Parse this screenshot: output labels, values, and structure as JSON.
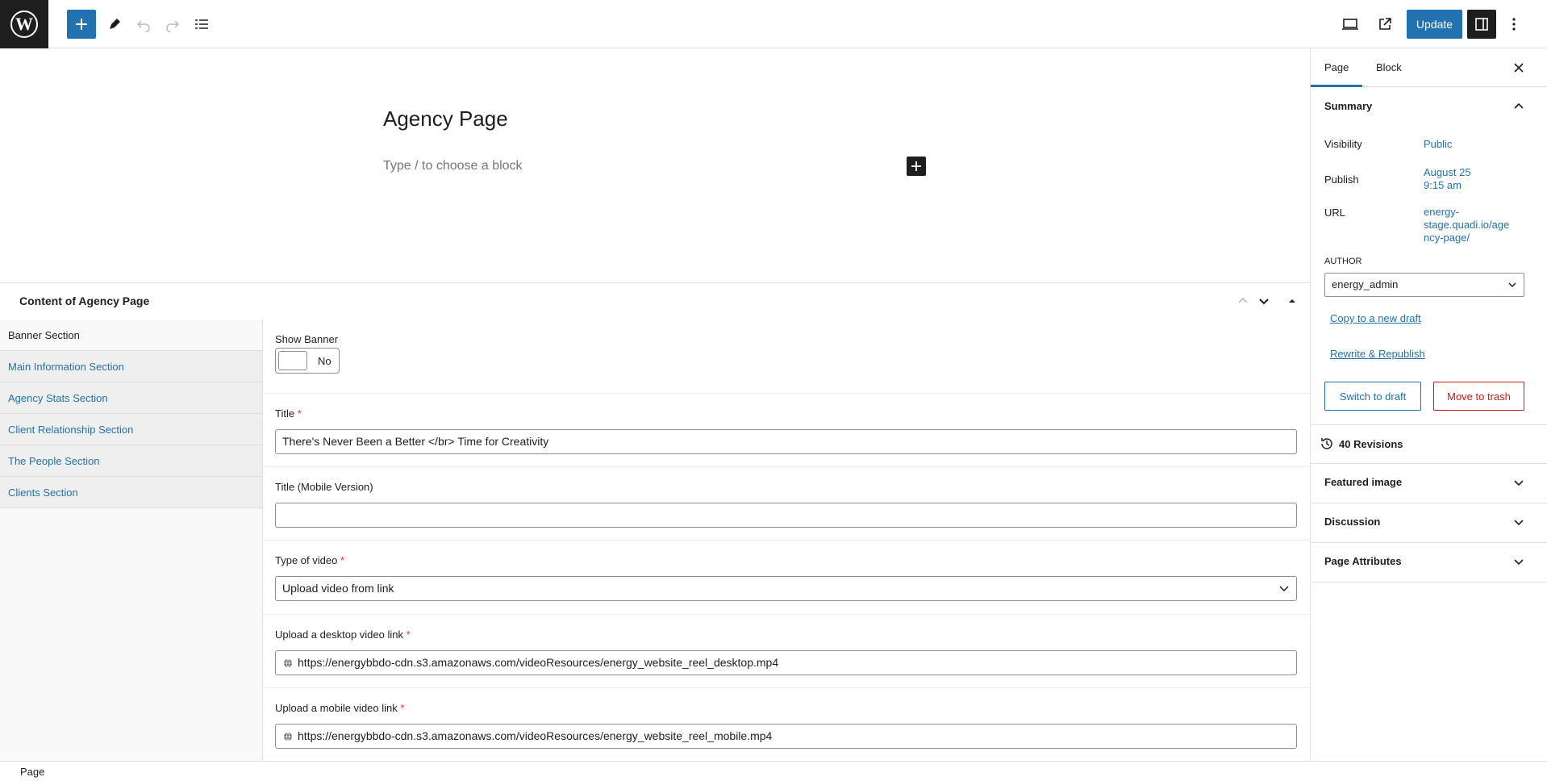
{
  "toolbar": {
    "logo": "W",
    "update_label": "Update",
    "icons": [
      "wordpress-logo",
      "plus-icon",
      "pencil-icon",
      "undo-icon",
      "redo-icon",
      "list-view-icon",
      "desktop-preview-icon",
      "external-link-icon",
      "sidebar-toggle-icon",
      "more-options-icon"
    ]
  },
  "editor": {
    "title": "Agency Page",
    "block_placeholder": "Type / to choose a block"
  },
  "metabox": {
    "title": "Content of Agency Page",
    "tabs": [
      {
        "label": "Banner Section"
      },
      {
        "label": "Main Information Section"
      },
      {
        "label": "Agency Stats Section"
      },
      {
        "label": "Client Relationship Section"
      },
      {
        "label": "The People Section"
      },
      {
        "label": "Clients Section"
      }
    ],
    "fields": {
      "show_banner": {
        "label": "Show Banner",
        "value": "No"
      },
      "title": {
        "label": "Title",
        "required": "*",
        "value": "There's Never Been a Better </br> Time for Creativity"
      },
      "title_mobile": {
        "label": "Title (Mobile Version)",
        "value": ""
      },
      "video_type": {
        "label": "Type of video",
        "required": "*",
        "value": "Upload video from link"
      },
      "desktop_video": {
        "label": "Upload a desktop video link",
        "required": "*",
        "value": "https://energybbdo-cdn.s3.amazonaws.com/videoResources/energy_website_reel_desktop.mp4"
      },
      "mobile_video": {
        "label": "Upload a mobile video link",
        "required": "*",
        "value": "https://energybbdo-cdn.s3.amazonaws.com/videoResources/energy_website_reel_mobile.mp4"
      }
    }
  },
  "sidebar": {
    "tabs": {
      "page": "Page",
      "block": "Block"
    },
    "summary": {
      "title": "Summary",
      "visibility_label": "Visibility",
      "visibility_value": "Public",
      "publish_label": "Publish",
      "publish_date": "August 25",
      "publish_time": "9:15 am",
      "url_label": "URL",
      "url_line1": "energy-",
      "url_line2": "stage.quadi.io/age",
      "url_line3": "ncy-page/",
      "author_label": "AUTHOR",
      "author_value": "energy_admin",
      "copy_draft": "Copy to a new draft",
      "rewrite": "Rewrite & Republish",
      "switch_draft": "Switch to draft",
      "move_trash": "Move to trash"
    },
    "revisions": "40 Revisions",
    "panels": {
      "featured": "Featured image",
      "discussion": "Discussion",
      "attributes": "Page Attributes"
    }
  },
  "footer": {
    "breadcrumb": "Page"
  },
  "colors": {
    "accent": "#2271b1",
    "danger": "#cc1818",
    "dark": "#1e1e1e"
  }
}
